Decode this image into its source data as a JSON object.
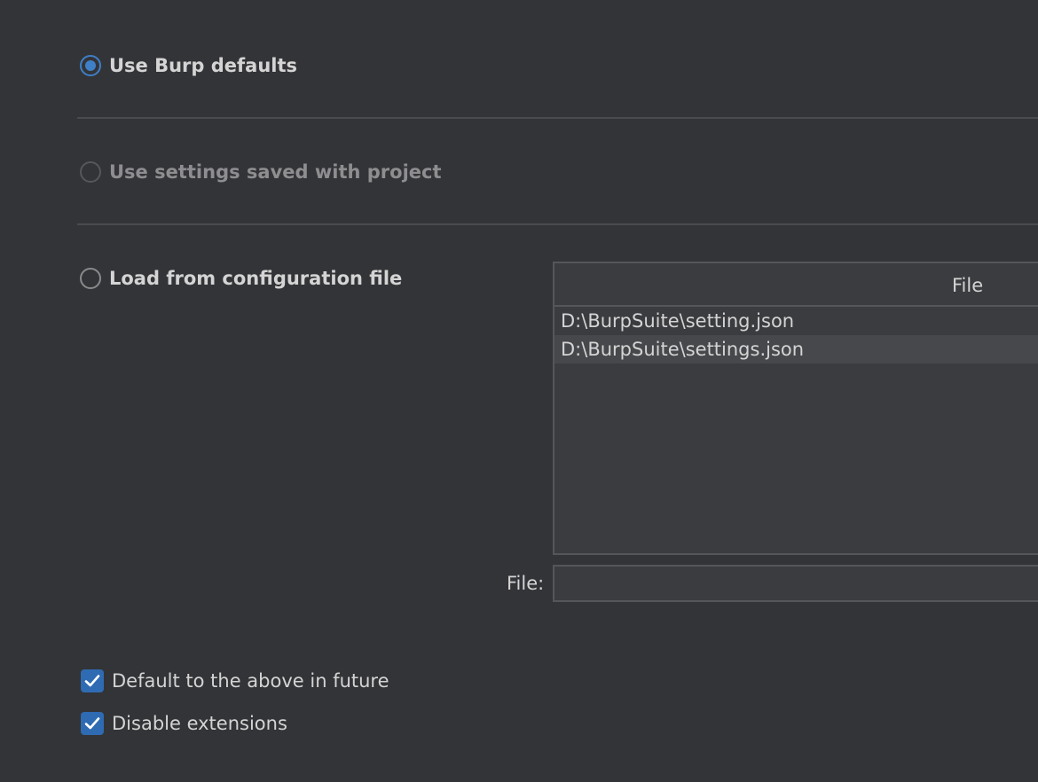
{
  "options": {
    "burp_defaults": {
      "label": "Use Burp defaults",
      "selected": true,
      "enabled": true
    },
    "project_settings": {
      "label": "Use settings saved with project",
      "selected": false,
      "enabled": false
    },
    "config_file": {
      "label": "Load from configuration file",
      "selected": false,
      "enabled": true
    }
  },
  "file_table": {
    "column_header": "File",
    "rows": [
      "D:\\BurpSuite\\setting.json",
      "D:\\BurpSuite\\settings.json"
    ]
  },
  "file_field": {
    "label": "File:",
    "value": ""
  },
  "checkboxes": {
    "default_future": {
      "label": "Default to the above in future",
      "checked": true
    },
    "disable_extensions": {
      "label": "Disable extensions",
      "checked": true
    }
  },
  "icons": {
    "radio_selected": "radio-selected-icon",
    "radio_empty": "radio-empty-icon",
    "checkmark": "checkmark-icon"
  },
  "colors": {
    "accent": "#3f7fc7",
    "checkbox_fill": "#2f6bb3",
    "background": "#333437"
  }
}
